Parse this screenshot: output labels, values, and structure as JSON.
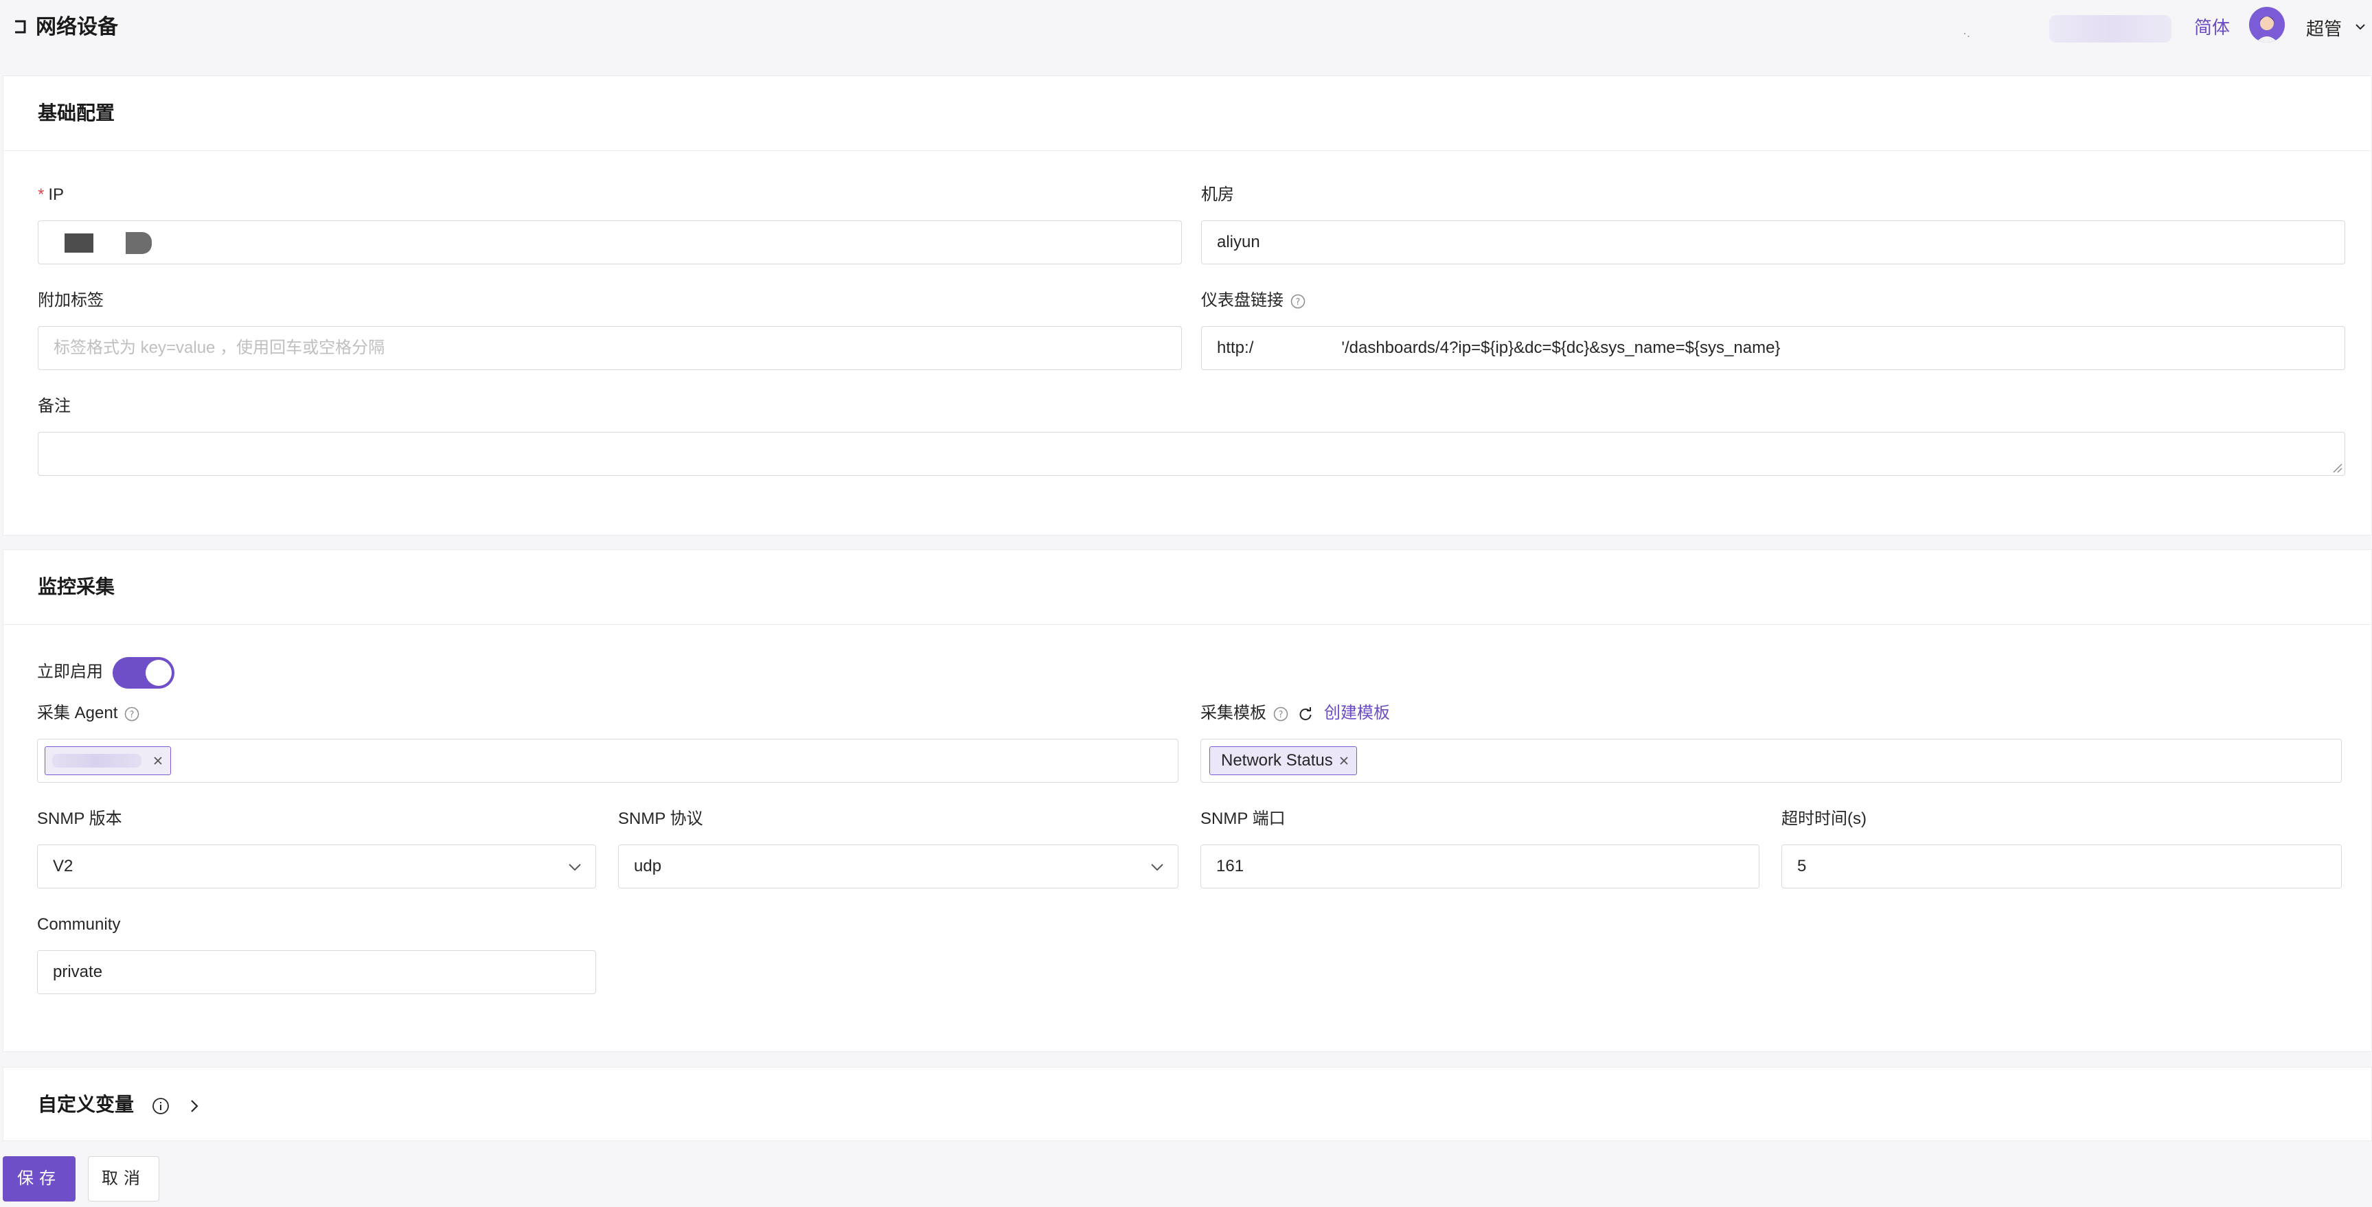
{
  "header": {
    "title": "网络设备",
    "blurred_text": "·.",
    "lang_label": "简体",
    "user_name": "超管"
  },
  "basic": {
    "section_title": "基础配置",
    "ip_label": "IP",
    "room_label": "机房",
    "room_value": "aliyun",
    "tags_label": "附加标签",
    "tags_placeholder": "标签格式为 key=value ，使用回车或空格分隔",
    "dashboard_label": "仪表盘链接",
    "dashboard_prefix": "http:/",
    "dashboard_suffix": "'/dashboards/4?ip=${ip}&dc=${dc}&sys_name=${sys_name}",
    "note_label": "备注",
    "note_value": ""
  },
  "monitor": {
    "section_title": "监控采集",
    "enable_label": "立即启用",
    "enabled": true,
    "agent_label": "采集 Agent",
    "template_label": "采集模板",
    "create_template_label": "创建模板",
    "template_tag": "Network Status",
    "snmp_version_label": "SNMP 版本",
    "snmp_version_value": "V2",
    "snmp_protocol_label": "SNMP 协议",
    "snmp_protocol_value": "udp",
    "snmp_port_label": "SNMP 端口",
    "snmp_port_value": "161",
    "timeout_label": "超时时间(s)",
    "timeout_value": "5",
    "community_label": "Community",
    "community_value": "private"
  },
  "custom": {
    "section_title": "自定义变量"
  },
  "footer": {
    "save_label": "保存",
    "cancel_label": "取消"
  },
  "colors": {
    "accent": "#6f4fc8",
    "required": "#e5484d",
    "background": "#f6f6f8"
  },
  "icons": [
    "back-icon",
    "avatar",
    "chevron-down-icon",
    "help-icon",
    "refresh-icon",
    "close-icon",
    "info-icon",
    "chevron-right-icon"
  ]
}
